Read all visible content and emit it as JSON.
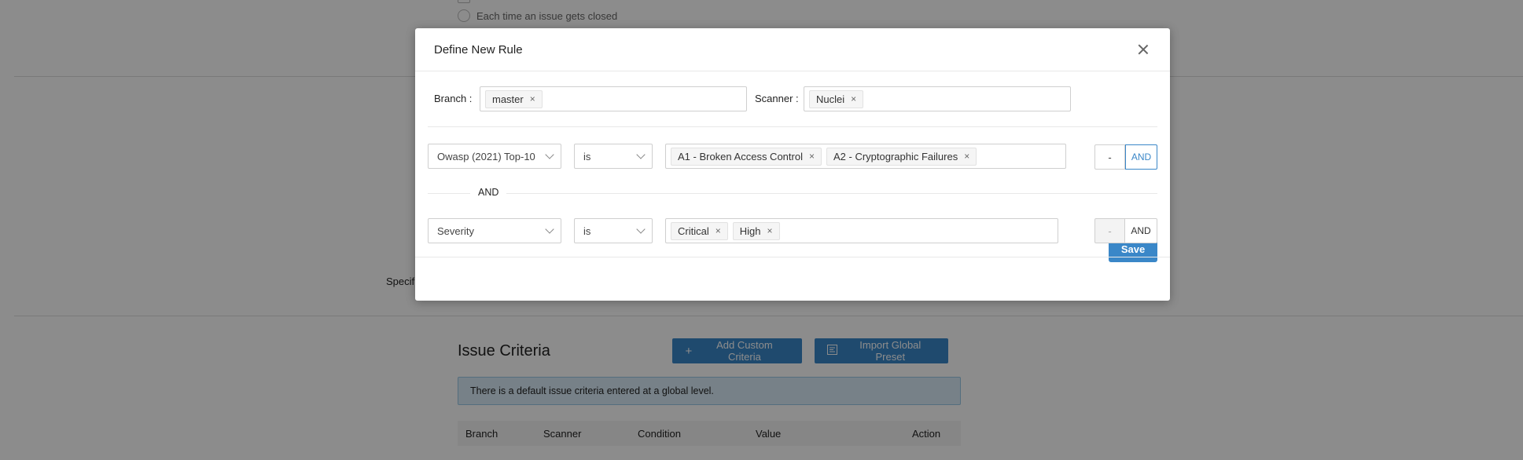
{
  "background": {
    "radio_option": "Each time an issue gets closed",
    "specify_label": "Specif",
    "issue_criteria": {
      "title": "Issue Criteria",
      "add_button": "Add Custom Criteria",
      "import_button": "Import Global Preset",
      "info_text": "There is a default issue criteria entered at a global level.",
      "columns": [
        "Branch",
        "Scanner",
        "Condition",
        "Value",
        "Action"
      ]
    }
  },
  "modal": {
    "title": "Define New Rule",
    "branch": {
      "label": "Branch :",
      "tags": [
        "master"
      ]
    },
    "scanner": {
      "label": "Scanner :",
      "tags": [
        "Nuclei"
      ]
    },
    "rule1": {
      "field": "Owasp (2021) Top-10",
      "operator": "is",
      "values": [
        "A1 - Broken Access Control",
        "A2 - Cryptographic Failures"
      ],
      "minus_label": "-",
      "and_label": "AND"
    },
    "separator": "AND",
    "rule2": {
      "field": "Severity",
      "operator": "is",
      "values": [
        "Critical",
        "High"
      ],
      "minus_label": "-",
      "and_label": "AND"
    },
    "save_label": "Save"
  },
  "icons": {
    "close": "close-icon",
    "tag_remove": "×",
    "add": "+",
    "import": "import-icon"
  },
  "colors": {
    "primary": "#3a87c8",
    "info_bg": "#d9ecf7"
  }
}
